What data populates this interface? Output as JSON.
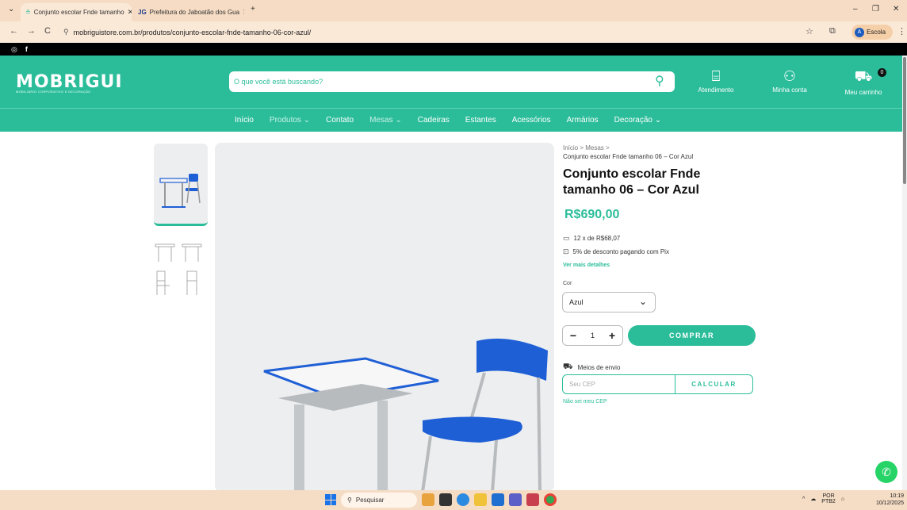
{
  "browser": {
    "tabs": [
      {
        "label": "Conjunto escolar Fnde tamanho",
        "active": true
      },
      {
        "label": "Prefeitura do Jaboatão dos Gua",
        "active": false
      }
    ],
    "new_tab": "+",
    "url": "mobriguistore.com.br/produtos/conjunto-escolar-fnde-tamanho-06-cor-azul/",
    "profile": "Escola",
    "profile_initial": "A"
  },
  "social": {
    "instagram": "◎",
    "facebook": "f"
  },
  "header": {
    "logo": "MOBRIGUI",
    "logo_sub": "MOBILIÁRIO CORPORATIVO E DECORAÇÃO",
    "search_placeholder": "O que você está buscando?",
    "atendimento": "Atendimento",
    "minha_conta": "Minha conta",
    "carrinho": "Meu carrinho",
    "cart_count": "0"
  },
  "nav": {
    "items": [
      "Início",
      "Produtos ⌄",
      "Contato",
      "Mesas ⌄",
      "Cadeiras",
      "Estantes",
      "Acessórios",
      "Armários",
      "Decoração ⌄"
    ]
  },
  "product": {
    "breadcrumb": "Início > Mesas >",
    "breadcrumb_current": "Conjunto escolar Fnde tamanho 06 – Cor Azul",
    "title": "Conjunto escolar Fnde tamanho 06 – Cor Azul",
    "price": "R$690,00",
    "installments": "12 x de R$68,07",
    "pix": "5% de desconto pagando com Pix",
    "more_details": "Ver mais detalhes",
    "color_label": "Cor",
    "color_value": "Azul",
    "qty": "1",
    "buy": "COMPRAR",
    "shipping_label": "Meios de envio",
    "cep_placeholder": "Seu CEP",
    "calc": "CALCULAR",
    "no_cep": "Não sei meu CEP"
  },
  "taskbar": {
    "search": "Pesquisar",
    "lang": "POR",
    "lang2": "PTB2",
    "time": "10:19",
    "date": "10/12/2025"
  },
  "colors": {
    "brand": "#2bbd9a",
    "accent_blue": "#1f5fd6"
  }
}
